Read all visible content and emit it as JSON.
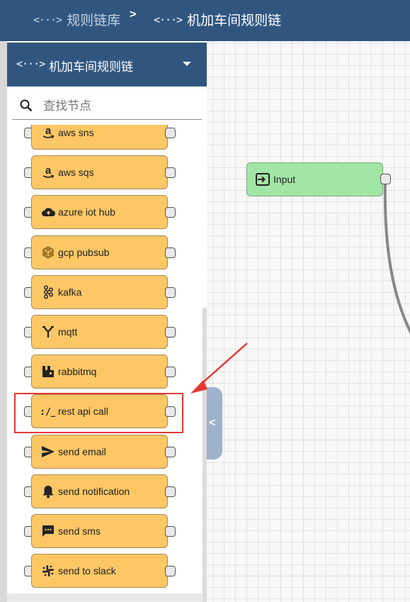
{
  "breadcrumb": {
    "root_label": "规则链库",
    "separator": ">",
    "current_label": "机加车间规则链"
  },
  "panel": {
    "title": "机加车间规则链"
  },
  "search": {
    "placeholder": "查找节点"
  },
  "nodes": [
    {
      "label": "aws sns",
      "icon": "amazon-icon"
    },
    {
      "label": "aws sqs",
      "icon": "amazon-icon"
    },
    {
      "label": "azure iot hub",
      "icon": "cloud-upload-icon"
    },
    {
      "label": "gcp pubsub",
      "icon": "gcp-hexagon-icon"
    },
    {
      "label": "kafka",
      "icon": "kafka-icon"
    },
    {
      "label": "mqtt",
      "icon": "merge-icon"
    },
    {
      "label": "rabbitmq",
      "icon": "rabbitmq-icon"
    },
    {
      "label": "rest api call",
      "icon": "api-slash-icon"
    },
    {
      "label": "send email",
      "icon": "send-icon"
    },
    {
      "label": "send notification",
      "icon": "bell-icon"
    },
    {
      "label": "send sms",
      "icon": "sms-icon"
    },
    {
      "label": "send to slack",
      "icon": "slack-icon"
    }
  ],
  "canvas": {
    "input_node_label": "Input"
  },
  "colors": {
    "header": "#305680",
    "node_fill": "#fdc766",
    "input_fill": "#a2e6a6",
    "highlight": "#e53935"
  }
}
